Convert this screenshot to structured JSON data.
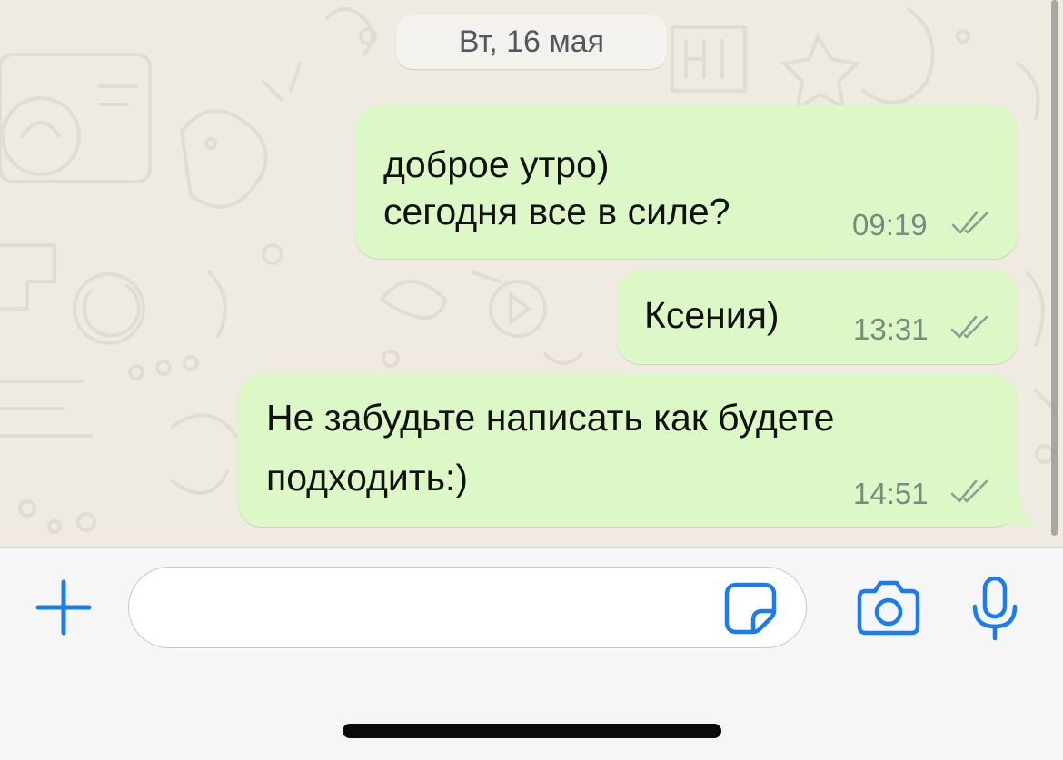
{
  "chat": {
    "date_label": "Вт, 16 мая",
    "messages": [
      {
        "lines": [
          "доброе утро)",
          "сегодня все в силе?"
        ],
        "time": "09:19",
        "status": "read"
      },
      {
        "lines": [
          "Ксения)"
        ],
        "time": "13:31",
        "status": "read"
      },
      {
        "lines": [
          "Не забудьте написать как будете",
          "подходить:)"
        ],
        "time": "14:51",
        "status": "read"
      }
    ]
  },
  "composer": {
    "value": "",
    "placeholder": ""
  },
  "icons": {
    "attach": "plus-icon",
    "sticker": "sticker-icon",
    "camera": "camera-icon",
    "microphone": "microphone-icon"
  },
  "colors": {
    "outgoing_bubble": "#dcf8c6",
    "chat_background": "#efeae2",
    "accent": "#1a7cf2",
    "read_ticks": "#8f9c92"
  }
}
